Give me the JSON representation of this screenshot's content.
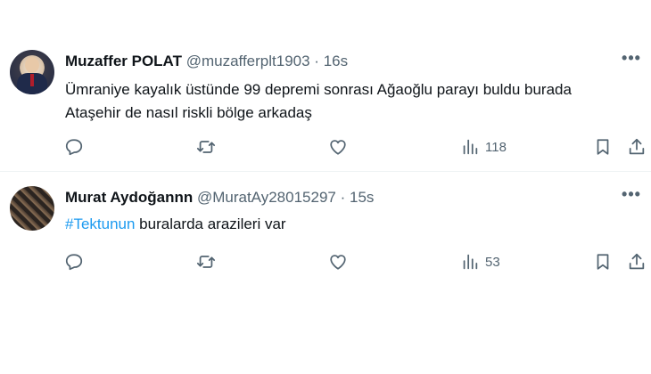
{
  "tweets": [
    {
      "name": "Muzaffer POLAT",
      "handle": "@muzafferplt1903",
      "separator": "·",
      "time": "16s",
      "more": "•••",
      "text_lines": [
        "Ümraniye kayalık üstünde 99 depremi sonrası Ağaoğlu parayı buldu burada",
        "Ataşehir de nasıl riskli bölge arkadaş"
      ],
      "views": "118"
    },
    {
      "name": "Murat Aydoğannn",
      "handle": "@MuratAy28015297",
      "separator": "·",
      "time": "15s",
      "more": "•••",
      "hashtag": "#Tektunun",
      "text_rest": " buralarda arazileri var",
      "views": "53"
    }
  ],
  "colors": {
    "text": "#0f1419",
    "muted": "#536471",
    "link": "#1d9bf0",
    "divider": "#eff3f4"
  },
  "icons": [
    "reply-icon",
    "retweet-icon",
    "like-icon",
    "views-icon",
    "bookmark-icon",
    "share-icon",
    "more-icon"
  ]
}
